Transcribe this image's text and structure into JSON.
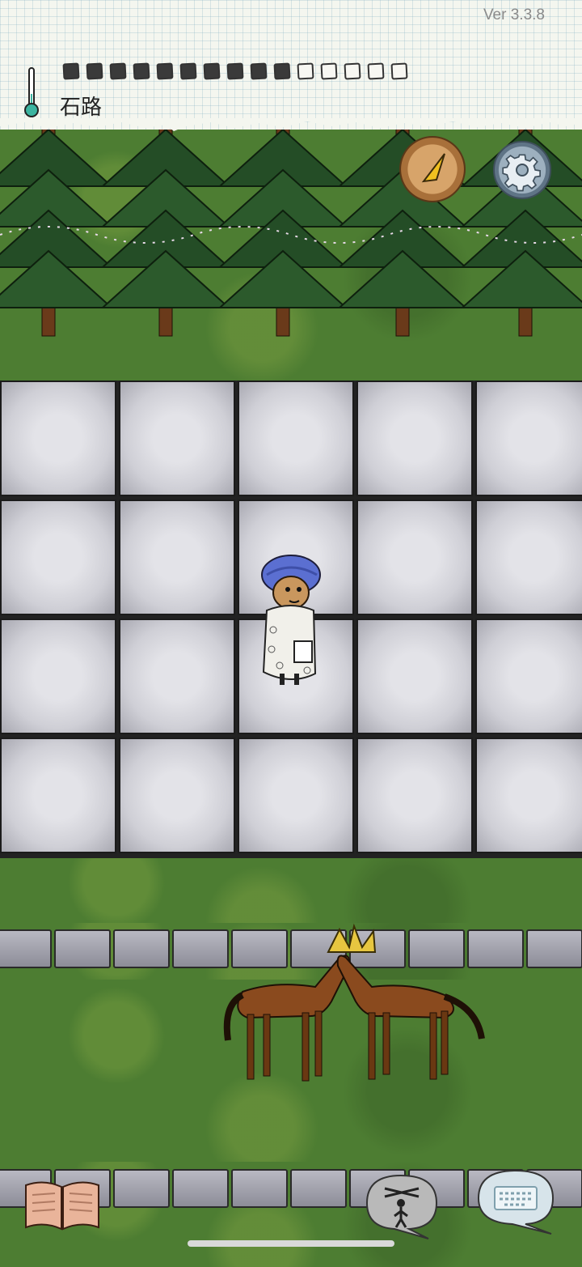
{
  "hud": {
    "version": "Ver 3.3.8",
    "biome": "石路",
    "food_pips_total": 15,
    "food_pips_filled": 10,
    "icons": {
      "thermometer": "thermometer-icon"
    }
  },
  "buttons": {
    "compass": "compass-icon",
    "settings": "gear-icon",
    "tech_book": "book-icon",
    "emote": "puppet-icon",
    "chat": "keyboard-icon"
  },
  "scene": {
    "player": "player-character",
    "animals": [
      "horse",
      "horse"
    ]
  },
  "colors": {
    "paper": "#f4f6ef",
    "grass": "#4d7d32",
    "stone": "#cfcfd6"
  }
}
